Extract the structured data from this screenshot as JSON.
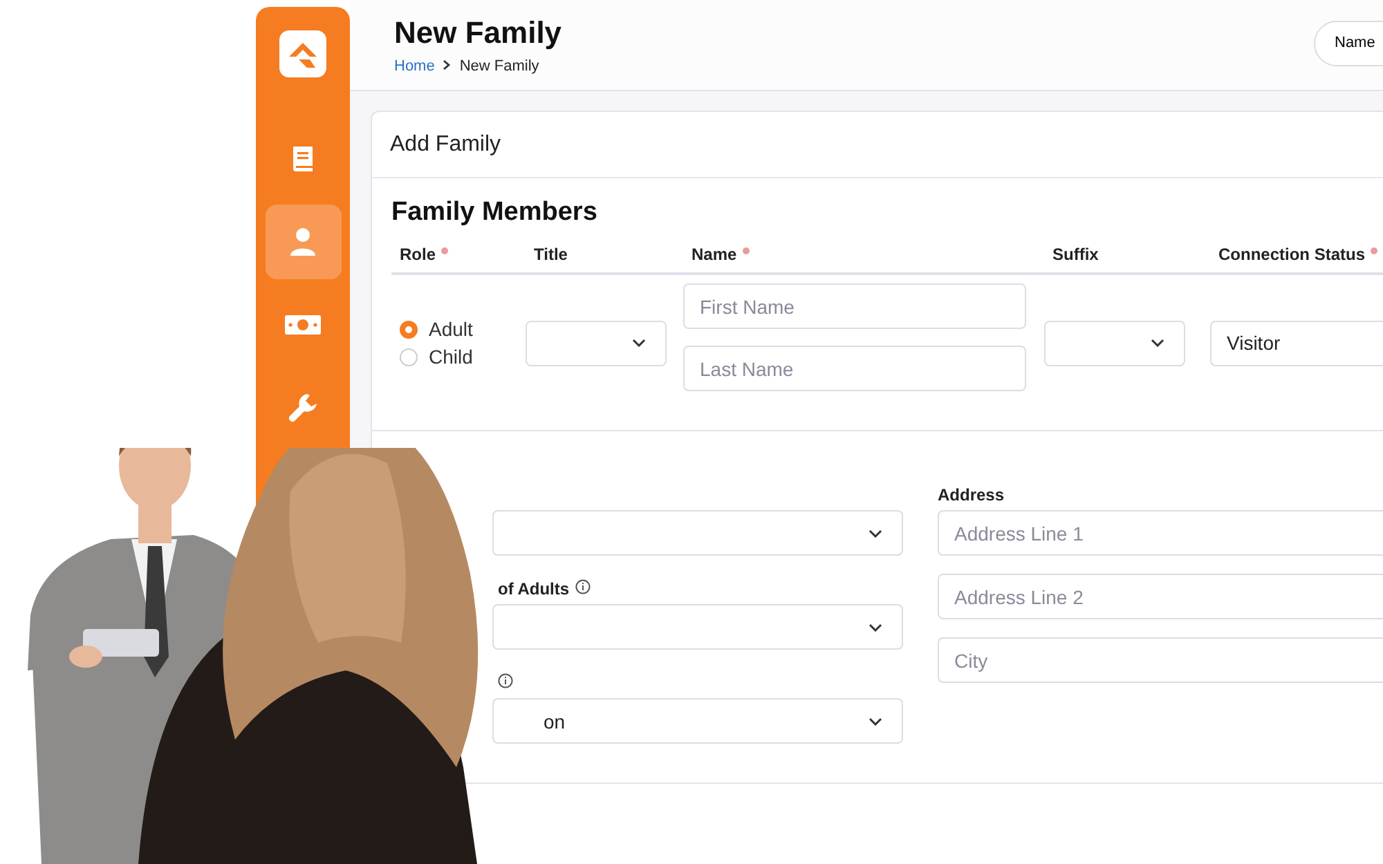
{
  "header": {
    "title": "New Family",
    "breadcrumb": [
      {
        "label": "Home",
        "link": true
      },
      {
        "label": "New Family",
        "link": false
      }
    ],
    "search_button": "Name"
  },
  "sidebar": {
    "items": [
      {
        "kind": "book",
        "selected": false
      },
      {
        "kind": "person",
        "selected": true
      },
      {
        "kind": "money",
        "selected": false
      },
      {
        "kind": "wrench",
        "selected": false
      }
    ]
  },
  "card": {
    "title": "Add Family",
    "members": {
      "title": "Family Members",
      "columns": [
        {
          "label": "Role",
          "required": true
        },
        {
          "label": "Title",
          "required": false
        },
        {
          "label": "Name",
          "required": true
        },
        {
          "label": "Suffix",
          "required": false
        },
        {
          "label": "Connection Status",
          "required": true
        }
      ],
      "row": {
        "roles": [
          {
            "label": "Adult",
            "selected": true
          },
          {
            "label": "Child",
            "selected": false
          }
        ],
        "first_name": {
          "placeholder": "First Name"
        },
        "last_name": {
          "placeholder": "Last Name"
        },
        "connection_status": "Visitor"
      }
    },
    "left_fields": [
      {
        "kind": "select"
      },
      {
        "kind": "select",
        "label": "of Adults",
        "info": true
      },
      {
        "kind": "select",
        "info": true,
        "value": "on"
      }
    ],
    "address": {
      "label": "Address",
      "fields": [
        {
          "placeholder": "Address Line 1"
        },
        {
          "placeholder": "Address Line 2"
        },
        {
          "placeholder": "City"
        }
      ]
    }
  }
}
